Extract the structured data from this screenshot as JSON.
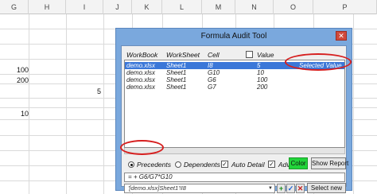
{
  "spreadsheet": {
    "columns": [
      "G",
      "H",
      "I",
      "J",
      "K",
      "L",
      "M",
      "N",
      "O",
      "P"
    ],
    "cells": [
      {
        "text": "100"
      },
      {
        "text": "200"
      },
      {
        "text": "5"
      },
      {
        "text": "10"
      }
    ]
  },
  "dialog": {
    "title": "Formula Audit Tool",
    "close_glyph": "✕",
    "headers": {
      "workbook": "WorkBook",
      "worksheet": "WorkSheet",
      "cell": "Cell",
      "value": "Value"
    },
    "rows": [
      {
        "workbook": "demo.xlsx",
        "worksheet": "Sheet1",
        "cell": "I8",
        "value": "5",
        "note": "Selected Value",
        "selected": true
      },
      {
        "workbook": "demo.xlsx",
        "worksheet": "Sheet1",
        "cell": "G10",
        "value": "10"
      },
      {
        "workbook": "demo.xlsx",
        "worksheet": "Sheet1",
        "cell": "G6",
        "value": "100"
      },
      {
        "workbook": "demo.xlsx",
        "worksheet": "Sheet1",
        "cell": "G7",
        "value": "200"
      }
    ],
    "options": {
      "precedents": "Precedents",
      "dependents": "Dependents",
      "auto_detail": "Auto Detail",
      "adv": "Adv",
      "check_mark": "✓"
    },
    "buttons": {
      "color": "Color",
      "show_report": "Show Report",
      "select_new": "Select new",
      "add": "+",
      "accept": "✓",
      "cancel": "✕"
    },
    "formula": "= + G6/G7*G10",
    "address": "'[demo.xlsx]Sheet1'!I8",
    "address_arrow": "▼",
    "colors": {
      "title_bar": "#7aa8dd",
      "selection": "#3b77d8",
      "color_button": "#22d43a",
      "highlight_oval": "#d61f1f"
    }
  }
}
